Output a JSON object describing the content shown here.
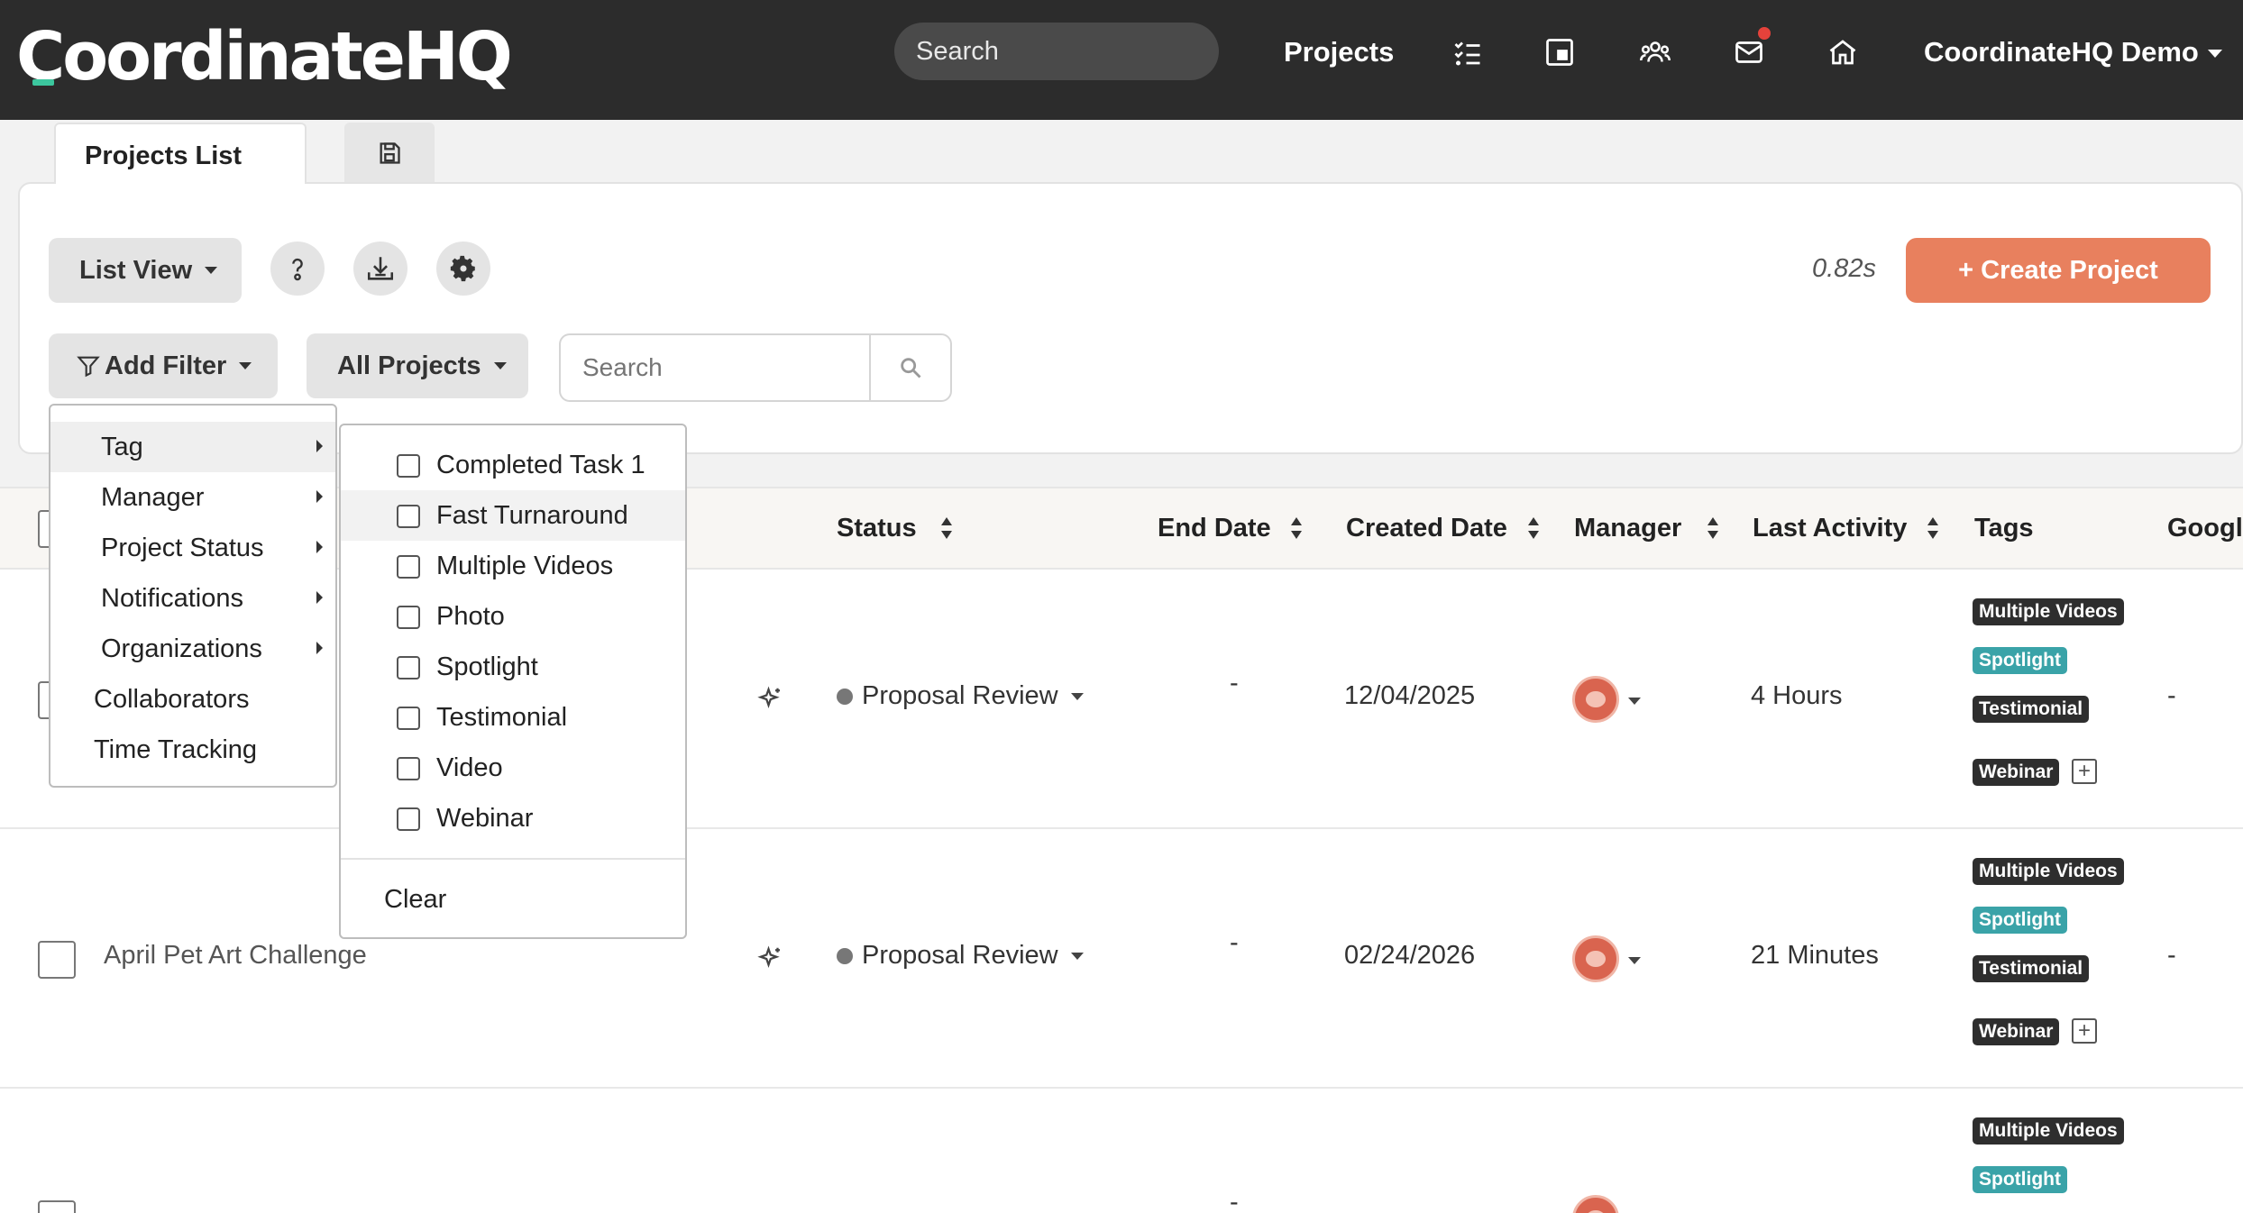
{
  "nav": {
    "logo": "CoordinateHQ",
    "search_label": "Search",
    "projects_label": "Projects",
    "user_label": "CoordinateHQ Demo",
    "icons": [
      "tasks-icon",
      "board-icon",
      "team-icon",
      "mail-icon",
      "home-icon"
    ],
    "notification_color": "#e5423b"
  },
  "tabs": {
    "active_label": "Projects List",
    "save_icon": "save-icon"
  },
  "toolbar": {
    "view_label": "List View",
    "timing": "0.82s",
    "create_label": "+ Create Project",
    "create_color": "#e8805e",
    "filter_label": "Add Filter",
    "scope_label": "All Projects",
    "search_placeholder": "Search"
  },
  "filter_menu": {
    "items": [
      {
        "label": "Tag",
        "submenu": true
      },
      {
        "label": "Manager",
        "submenu": true
      },
      {
        "label": "Project Status",
        "submenu": true
      },
      {
        "label": "Notifications",
        "submenu": true
      },
      {
        "label": "Organizations",
        "submenu": true
      },
      {
        "label": "Collaborators",
        "submenu": false
      },
      {
        "label": "Time Tracking",
        "submenu": false
      }
    ]
  },
  "tag_submenu": {
    "options": [
      "Completed Task 1",
      "Fast Turnaround",
      "Multiple Videos",
      "Photo",
      "Spotlight",
      "Testimonial",
      "Video",
      "Webinar"
    ],
    "clear_label": "Clear"
  },
  "table": {
    "columns": [
      "Status",
      "End Date",
      "Created Date",
      "Manager",
      "Last Activity",
      "Tags",
      "Googl"
    ],
    "rows": [
      {
        "name": "",
        "status": "Proposal Review",
        "end_date": "-",
        "created_date": "12/04/2025",
        "last_activity": "4 Hours",
        "tags": [
          "Multiple Videos",
          "Spotlight",
          "Testimonial",
          "Webinar"
        ],
        "google": "-"
      },
      {
        "name": "April Pet Art Challenge",
        "status": "Proposal Review",
        "end_date": "-",
        "created_date": "02/24/2026",
        "last_activity": "21 Minutes",
        "tags": [
          "Multiple Videos",
          "Spotlight",
          "Testimonial",
          "Webinar"
        ],
        "google": "-"
      },
      {
        "name": "",
        "status": "",
        "end_date": "-",
        "created_date": "",
        "last_activity": "",
        "tags": [
          "Multiple Videos",
          "Spotlight"
        ],
        "google": ""
      }
    ],
    "tag_colors": {
      "dark": "#2e2e2e",
      "teal": "#3aa3a8"
    }
  }
}
